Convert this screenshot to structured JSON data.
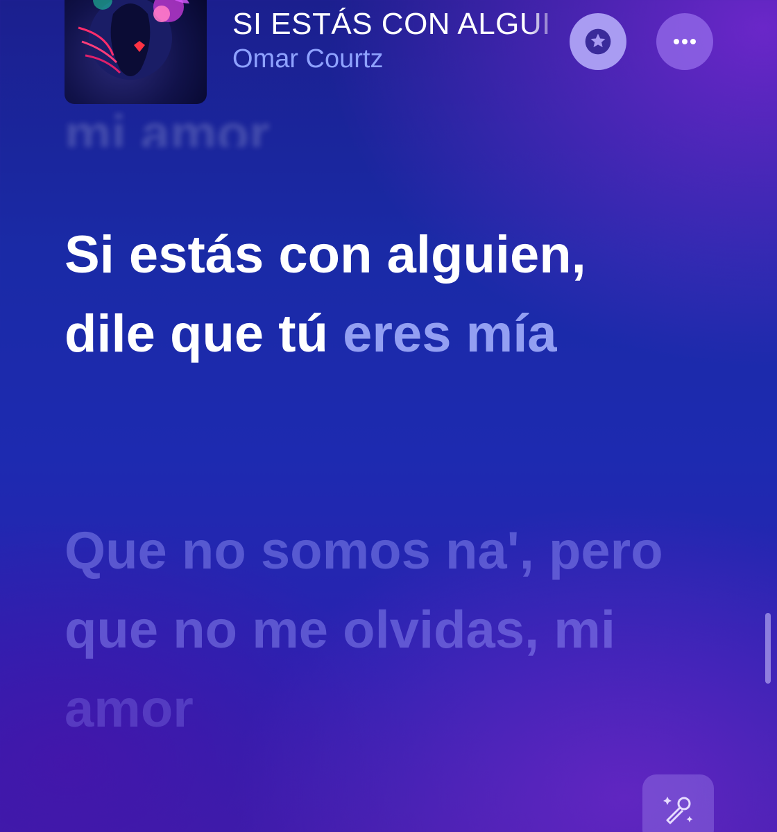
{
  "now_playing": {
    "title": "SI ESTÁS CON ALGUI",
    "artist": "Omar Courtz"
  },
  "lyrics": {
    "previous_line_fragment": "mi amor",
    "current_line": {
      "sung": "Si estás con alguien, dile que tú",
      "pending": "eres mía"
    },
    "next_line": "Que no somos na', pero que no me olvidas, mi",
    "next_line_end": "amor"
  },
  "icons": {
    "favorite": "star-icon",
    "more": "ellipsis-icon",
    "lyrics_mode": "microphone-sparkles-icon"
  },
  "colors": {
    "artist": "#8fa2ff",
    "favorite_button": "#a99cf2"
  }
}
